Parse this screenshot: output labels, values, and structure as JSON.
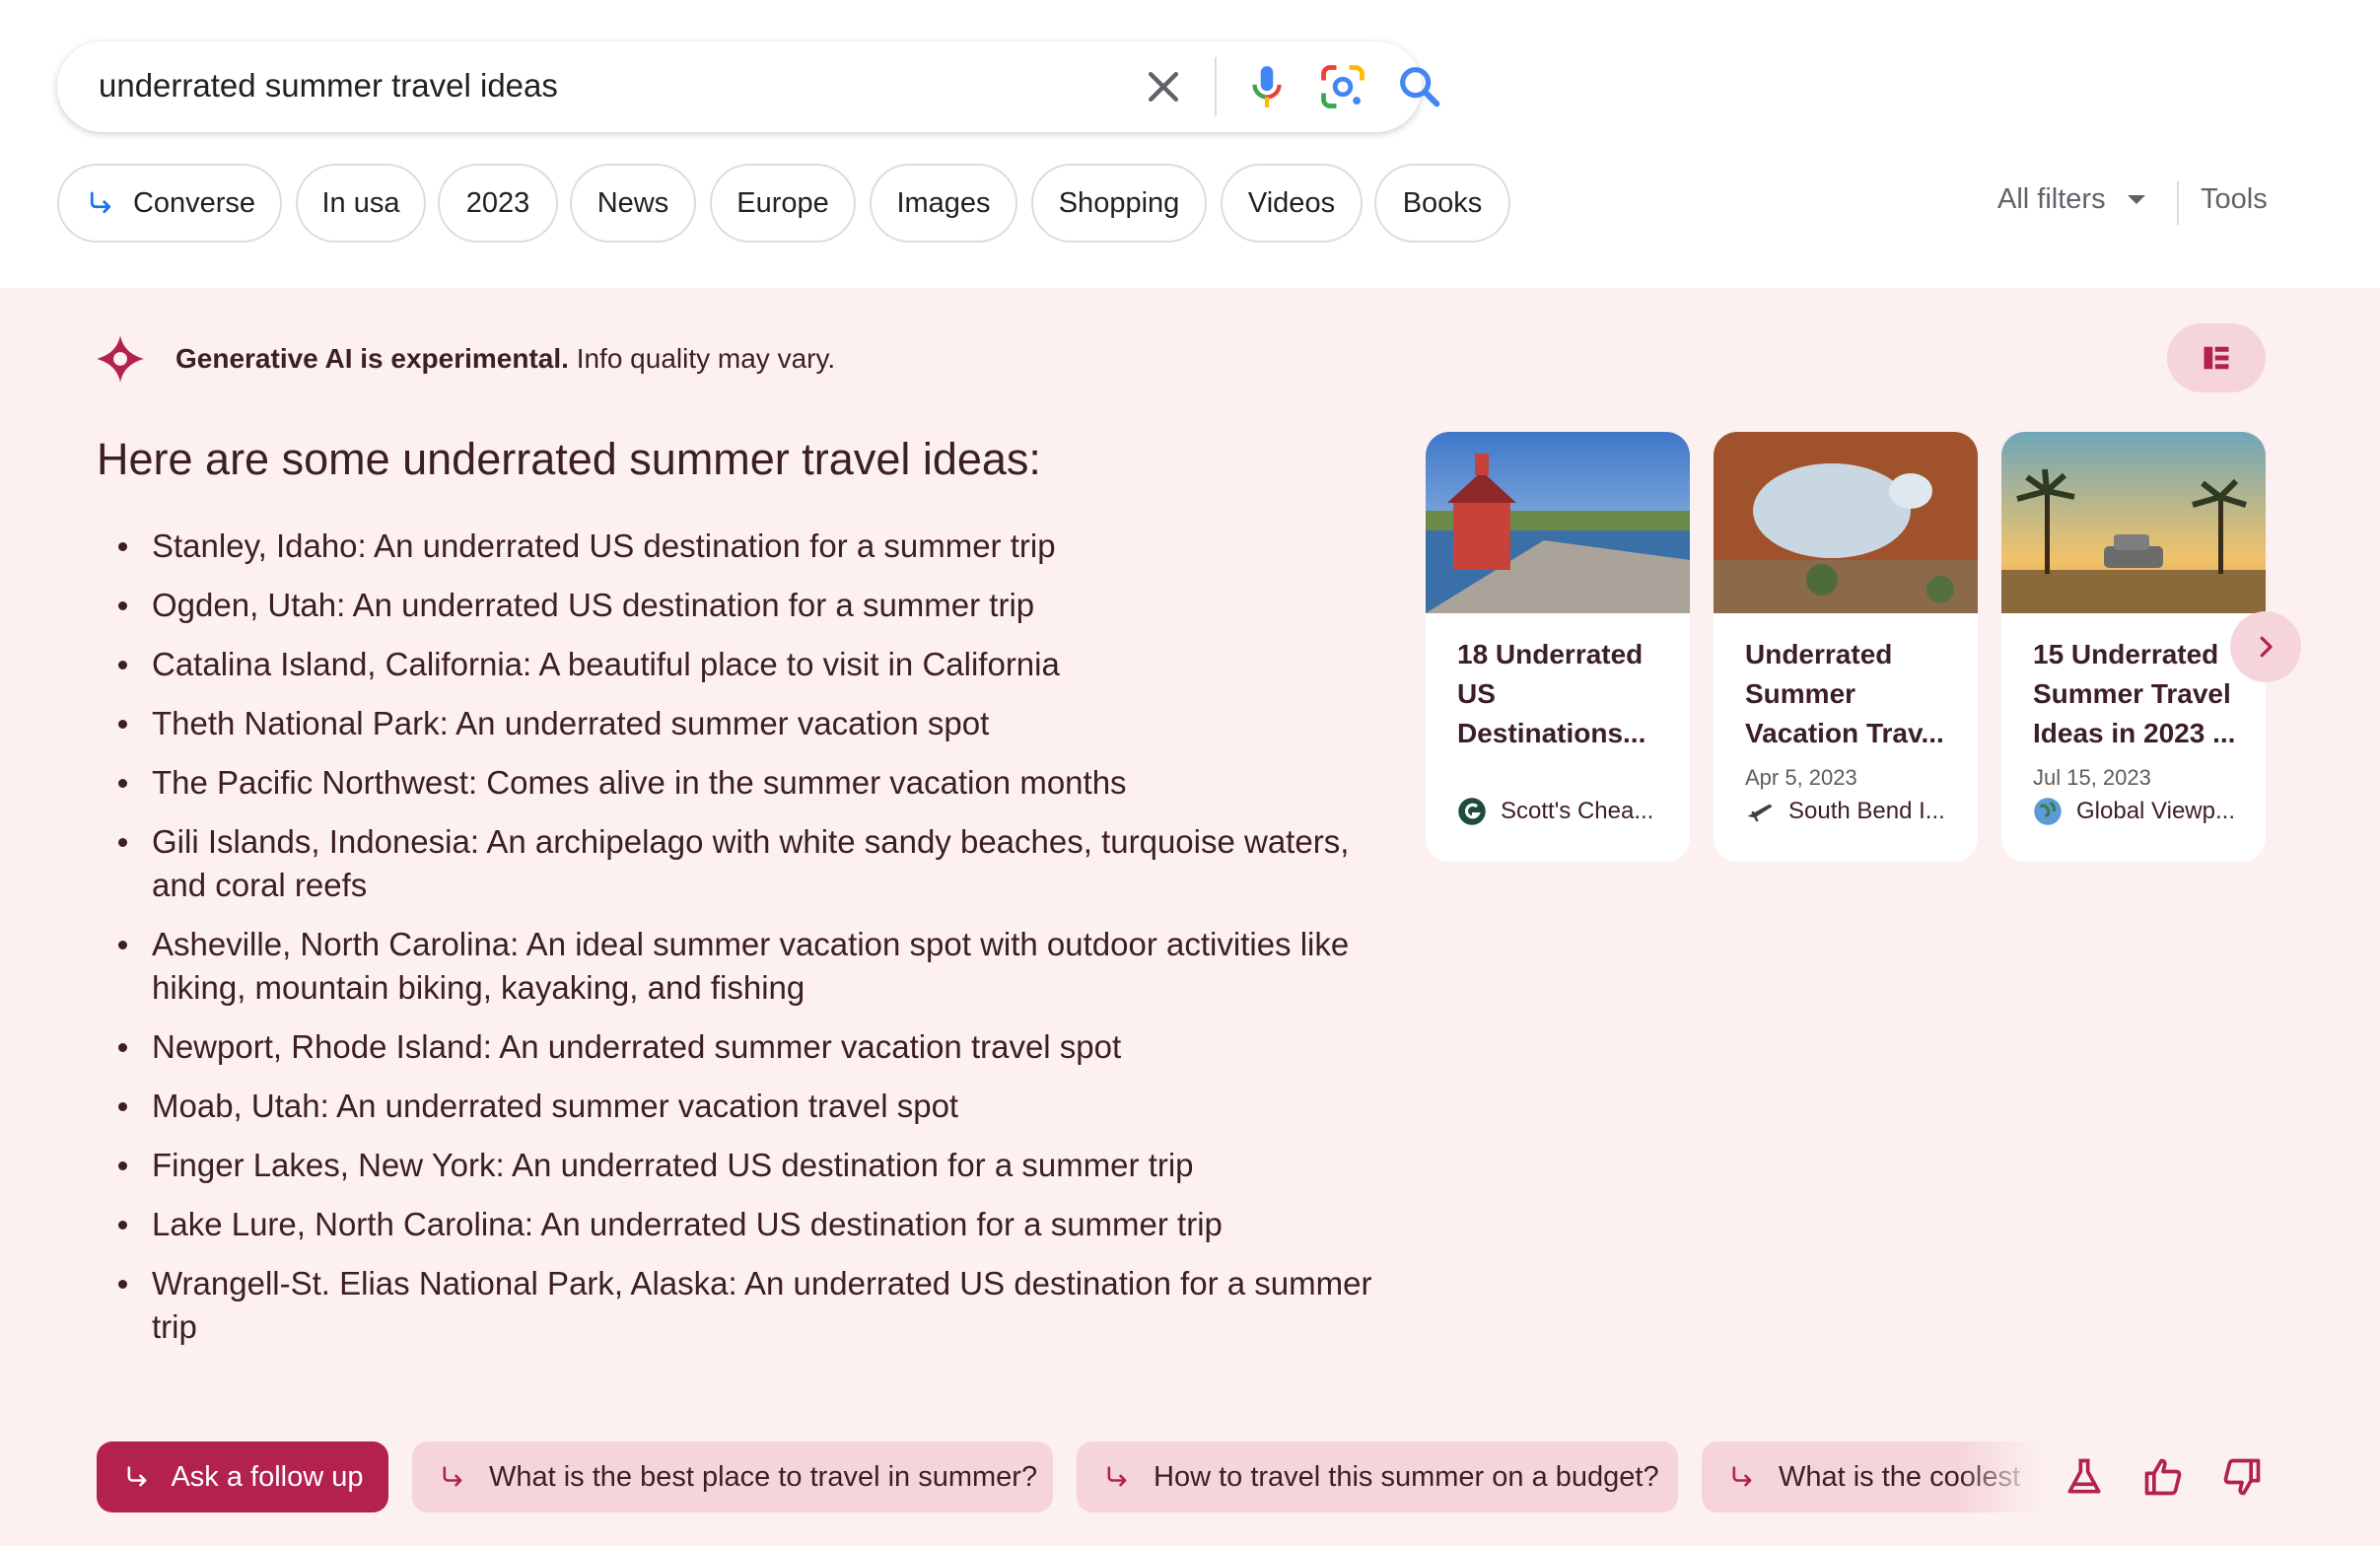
{
  "search": {
    "query": "underrated summer travel ideas"
  },
  "chips": [
    {
      "label": "Converse",
      "icon": "arrow-return-icon"
    },
    {
      "label": "In usa"
    },
    {
      "label": "2023"
    },
    {
      "label": "News"
    },
    {
      "label": "Europe"
    },
    {
      "label": "Images"
    },
    {
      "label": "Shopping"
    },
    {
      "label": "Videos"
    },
    {
      "label": "Books"
    }
  ],
  "toolbar": {
    "all_filters": "All filters",
    "tools": "Tools"
  },
  "sge": {
    "disclaimer_bold": "Generative AI is experimental.",
    "disclaimer_rest": " Info quality may vary.",
    "title": "Here are some underrated summer travel ideas:",
    "items": [
      "Stanley, Idaho: An underrated US destination for a summer trip",
      "Ogden, Utah: An underrated US destination for a summer trip",
      "Catalina Island, California: A beautiful place to visit in California",
      "Theth National Park: An underrated summer vacation spot",
      "The Pacific Northwest: Comes alive in the summer vacation months",
      "Gili Islands, Indonesia: An archipelago with white sandy beaches, turquoise waters, and coral reefs",
      "Asheville, North Carolina: An ideal summer vacation spot with outdoor activities like hiking, mountain biking, kayaking, and fishing",
      "Newport, Rhode Island: An underrated summer vacation travel spot",
      "Moab, Utah: An underrated summer vacation travel spot",
      "Finger Lakes, New York: An underrated US destination for a summer trip",
      "Lake Lure, North Carolina: An underrated US destination for a summer trip",
      "Wrangell-St. Elias National Park, Alaska: An underrated US destination for a summer trip"
    ],
    "cards": [
      {
        "title": "18 Underrated US Destinations...",
        "date": "",
        "source": "Scott's Chea..."
      },
      {
        "title": "Underrated Summer Vacation Trav...",
        "date": "Apr 5, 2023",
        "source": "South Bend I..."
      },
      {
        "title": "15 Underrated Summer Travel Ideas in 2023 ...",
        "date": "Jul 15, 2023",
        "source": "Global Viewp..."
      }
    ]
  },
  "followup": {
    "ask_label": "Ask a follow up",
    "suggestions": [
      "What is the best place to travel in summer?",
      "How to travel this summer on a budget?",
      "What is the coolest"
    ]
  },
  "colors": {
    "accent": "#b3214f",
    "panel_bg": "#fcf0f0",
    "chip_pink": "#f5d5db",
    "text_dark": "#3c1e25"
  }
}
